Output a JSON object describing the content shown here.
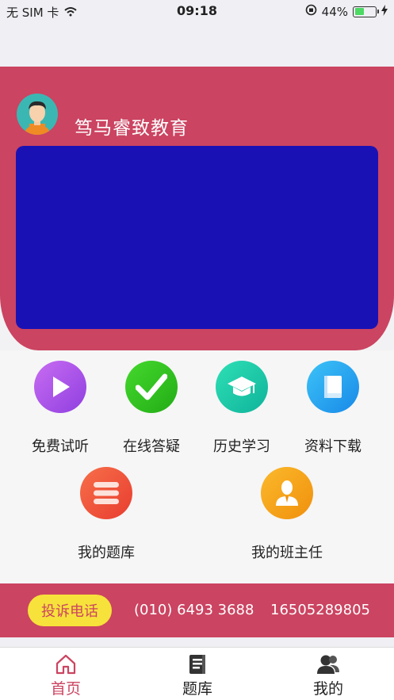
{
  "status_bar": {
    "carrier": "无 SIM 卡",
    "time": "09:18",
    "battery": "44%",
    "battery_level": 0.44
  },
  "header": {
    "brand_name": "笃马睿致教育"
  },
  "menu": {
    "items": [
      {
        "label": "免费试听",
        "icon": "play-icon",
        "color": "#a94be6"
      },
      {
        "label": "在线答疑",
        "icon": "check-icon",
        "color": "#2fc01d"
      },
      {
        "label": "历史学习",
        "icon": "graduation-cap-icon",
        "color": "#17c9a6"
      },
      {
        "label": "资料下载",
        "icon": "book-icon",
        "color": "#1e9fef"
      },
      {
        "label": "我的题库",
        "icon": "list-icon",
        "color": "#f2553a"
      },
      {
        "label": "我的班主任",
        "icon": "teacher-icon",
        "color": "#f5a516"
      }
    ]
  },
  "complaint": {
    "button_label": "投诉电话",
    "phone_1": "(010) 6493 3688",
    "phone_2": "16505289805"
  },
  "tabbar": {
    "tabs": [
      {
        "label": "首页",
        "icon": "home-icon",
        "active": true
      },
      {
        "label": "题库",
        "icon": "question-bank-icon",
        "active": false
      },
      {
        "label": "我的",
        "icon": "user-icon",
        "active": false
      }
    ],
    "active_color": "#cb4461"
  }
}
